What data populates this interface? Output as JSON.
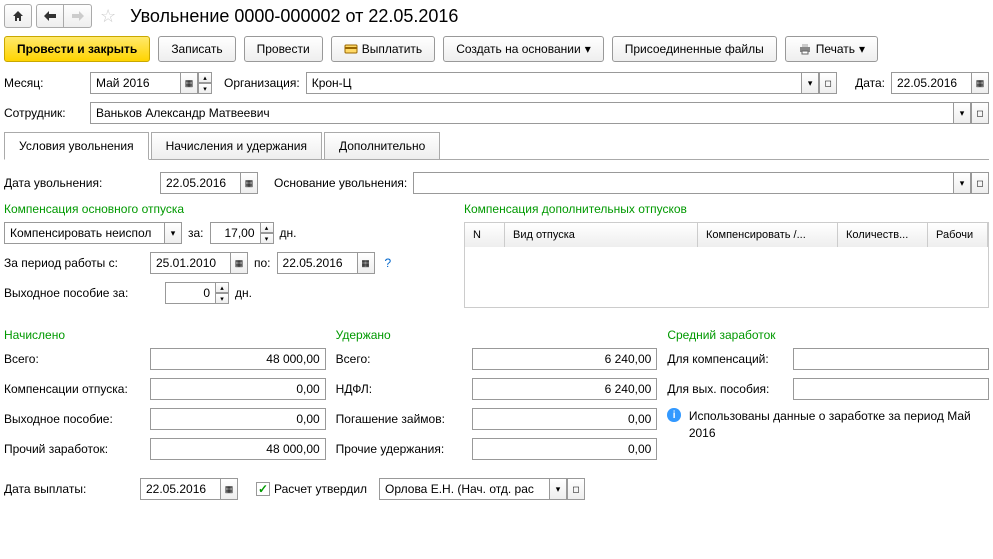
{
  "header": {
    "title": "Увольнение 0000-000002 от 22.05.2016"
  },
  "toolbar": {
    "post_close": "Провести и закрыть",
    "write": "Записать",
    "post": "Провести",
    "pay": "Выплатить",
    "create_based": "Создать на основании",
    "attached": "Присоединенные файлы",
    "print": "Печать"
  },
  "fields": {
    "month_label": "Месяц:",
    "month": "Май 2016",
    "org_label": "Организация:",
    "org": "Крон-Ц",
    "date_label": "Дата:",
    "date": "22.05.2016",
    "employee_label": "Сотрудник:",
    "employee": "Ваньков Александр Матвеевич"
  },
  "tabs": {
    "t1": "Условия увольнения",
    "t2": "Начисления и удержания",
    "t3": "Дополнительно"
  },
  "dismiss": {
    "date_label": "Дата увольнения:",
    "date": "22.05.2016",
    "basis_label": "Основание увольнения:",
    "basis": ""
  },
  "comp_main": {
    "title": "Компенсация основного отпуска",
    "action": "Компенсировать неиспол",
    "za": "за:",
    "days": "17,00",
    "days_unit": "дн.",
    "period_label": "За период работы с:",
    "from": "25.01.2010",
    "po": "по:",
    "to": "22.05.2016",
    "severance_label": "Выходное пособие за:",
    "severance_days": "0",
    "severance_unit": "дн."
  },
  "comp_add": {
    "title": "Компенсация дополнительных отпусков",
    "col_n": "N",
    "col_type": "Вид отпуска",
    "col_comp": "Компенсировать /...",
    "col_qty": "Количеств...",
    "col_work": "Рабочи"
  },
  "accrued": {
    "title": "Начислено",
    "total_label": "Всего:",
    "total": "48 000,00",
    "comp_label": "Компенсации отпуска:",
    "comp": "0,00",
    "sev_label": "Выходное пособие:",
    "sev": "0,00",
    "other_label": "Прочий заработок:",
    "other": "48 000,00"
  },
  "withheld": {
    "title": "Удержано",
    "total_label": "Всего:",
    "total": "6 240,00",
    "ndfl_label": "НДФЛ:",
    "ndfl": "6 240,00",
    "loan_label": "Погашение займов:",
    "loan": "0,00",
    "other_label": "Прочие удержания:",
    "other": "0,00"
  },
  "avg": {
    "title": "Средний заработок",
    "comp_label": "Для компенсаций:",
    "sev_label": "Для вых. пособия:",
    "info": "Использованы данные о заработке за период Май 2016"
  },
  "footer": {
    "pay_date_label": "Дата выплаты:",
    "pay_date": "22.05.2016",
    "approved_label": "Расчет утвердил",
    "approver": "Орлова Е.Н. (Нач. отд. рас"
  }
}
